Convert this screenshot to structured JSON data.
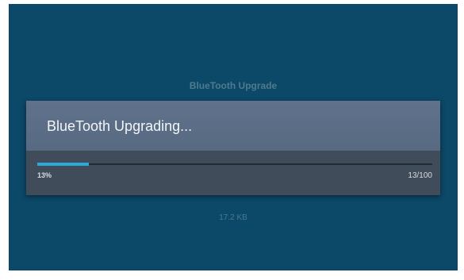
{
  "background": {
    "title": "BlueTooth Upgrade",
    "size_text": "17.2 KB"
  },
  "dialog": {
    "title": "BlueTooth Upgrading...",
    "progress": {
      "percent_label": "13%",
      "count_label": "13/100",
      "value": 0.13
    }
  },
  "colors": {
    "screen_background": "#0c4868",
    "dialog_header": "#5b6e87",
    "dialog_body": "#414c5a",
    "progress_fill": "#2aa9dc",
    "progress_track": "#222a33"
  }
}
